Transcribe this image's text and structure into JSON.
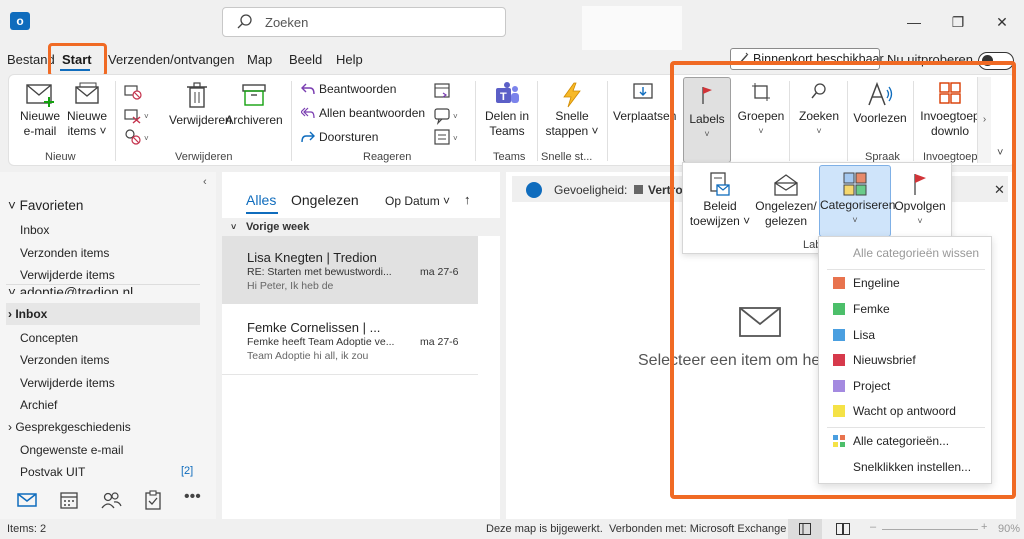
{
  "search": {
    "placeholder": "Zoeken"
  },
  "menu": {
    "tabs": [
      "Bestand",
      "Start",
      "Verzenden/ontvangen",
      "Map",
      "Beeld",
      "Help"
    ],
    "soon_label": "Binnenkort beschikbaar",
    "try_label": "Nu uitproberen"
  },
  "ribbon": {
    "new_email": [
      "Nieuwe",
      "e-mail"
    ],
    "new_items": [
      "Nieuwe",
      "items ˅"
    ],
    "group_new": "Nieuw",
    "delete": "Verwijderen",
    "archive": "Archiveren",
    "group_delete": "Verwijderen",
    "reply": "Beantwoorden",
    "reply_all": "Allen beantwoorden",
    "forward": "Doorsturen",
    "group_reply": "Reageren",
    "share_teams": [
      "Delen in",
      "Teams"
    ],
    "group_teams": "Teams",
    "quick_steps": [
      "Snelle",
      "stappen ˅"
    ],
    "group_quick": "Snelle st...",
    "move": "Verplaatsen",
    "labels": "Labels",
    "groups": "Groepen",
    "find": "Zoeken",
    "read_aloud": "Voorlezen",
    "group_speech": "Spraak",
    "addins": [
      "Invoegtoep",
      "downlo"
    ],
    "group_addins": "Invoegtoep"
  },
  "labels_panel": {
    "policy": [
      "Beleid",
      "toewijzen ˅"
    ],
    "unread": [
      "Ongelezen/",
      "gelezen"
    ],
    "categorize": "Categoriseren",
    "followup": "Opvolgen",
    "group": "Lab"
  },
  "categories": {
    "clear_all": "Alle categorieën wissen",
    "items": [
      {
        "name": "Engeline",
        "color": "#e8734e"
      },
      {
        "name": "Femke",
        "color": "#4cbf6a"
      },
      {
        "name": "Lisa",
        "color": "#4a9fe0"
      },
      {
        "name": "Nieuwsbrief",
        "color": "#d6394b"
      },
      {
        "name": "Project",
        "color": "#a48ae0"
      },
      {
        "name": "Wacht op antwoord",
        "color": "#f5e246"
      }
    ],
    "all": "Alle categorieën...",
    "quick_click": "Snelklikken instellen..."
  },
  "folders": {
    "favorites_head": "Favorieten",
    "favorites": [
      "Inbox",
      "Verzonden items",
      "Verwijderde items"
    ],
    "account": "adoptie@tredion.nl",
    "inbox": "Inbox",
    "items": [
      "Concepten",
      "Verzonden items",
      "Verwijderde items",
      "Archief"
    ],
    "history": "Gesprekgeschiedenis",
    "junk": "Ongewenste e-mail",
    "outbox": "Postvak UIT",
    "outbox_count": "[2]"
  },
  "messages": {
    "tab_all": "Alles",
    "tab_unread": "Ongelezen",
    "sort": "Op Datum ˅",
    "group": "Vorige week",
    "list": [
      {
        "from": "Lisa Knegten | Tredion",
        "subject": "RE: Starten met bewustwordi...",
        "date": "ma 27-6",
        "preview": "Hi Peter,   Ik heb de"
      },
      {
        "from": "Femke Cornelissen | ...",
        "subject": "Femke heeft Team Adoptie ve...",
        "date": "ma 27-6",
        "preview": "Team Adoptie  hi all, ik zou"
      }
    ]
  },
  "reading": {
    "sensitivity_label": "Gevoeligheid:",
    "sensitivity_value": "Vertrou",
    "select_text": "Selecteer een item om he"
  },
  "status": {
    "items": "Items: 2",
    "updated": "Deze map is bijgewerkt.",
    "connected": "Verbonden met: Microsoft Exchange",
    "zoom": "90%"
  }
}
